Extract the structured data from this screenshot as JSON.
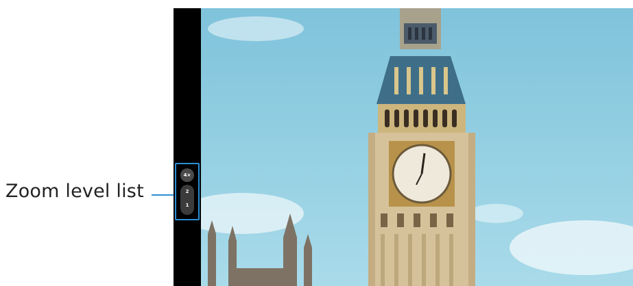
{
  "callout": {
    "label": "Zoom level list"
  },
  "zoom": {
    "current": "4×",
    "levels": [
      "2",
      "1"
    ]
  },
  "colors": {
    "highlight": "#2a8fd6",
    "sky": "#87c8de",
    "stone": "#d6c29a"
  }
}
